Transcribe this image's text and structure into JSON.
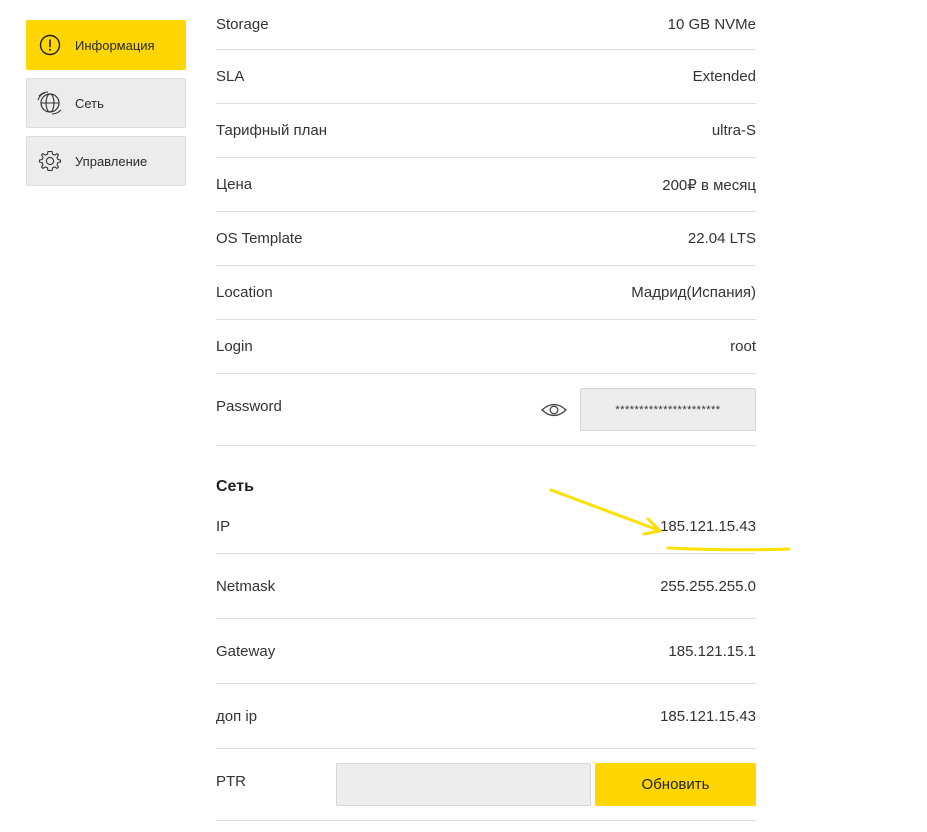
{
  "sidebar": {
    "items": [
      {
        "label": "Информация",
        "icon": "info-circle-icon",
        "active": true
      },
      {
        "label": "Сеть",
        "icon": "network-icon",
        "active": false
      },
      {
        "label": "Управление",
        "icon": "gear-icon",
        "active": false
      }
    ]
  },
  "info": {
    "rows": [
      {
        "label": "Storage",
        "value": "10 GB NVMe"
      },
      {
        "label": "SLA",
        "value": "Extended"
      },
      {
        "label": "Тарифный план",
        "value": "ultra-S"
      },
      {
        "label": "Цена",
        "value": "200₽ в месяц"
      },
      {
        "label": "OS Template",
        "value": "22.04 LTS"
      },
      {
        "label": "Location",
        "value": "Мадрид(Испания)"
      },
      {
        "label": "Login",
        "value": "root"
      }
    ],
    "password": {
      "label": "Password",
      "masked_value": "**********************"
    }
  },
  "network": {
    "title": "Сеть",
    "rows": [
      {
        "label": "IP",
        "value": "185.121.15.43"
      },
      {
        "label": "Netmask",
        "value": "255.255.255.0"
      },
      {
        "label": "Gateway",
        "value": "185.121.15.1"
      },
      {
        "label": "доп ip",
        "value": "185.121.15.43"
      }
    ],
    "ptr": {
      "label": "PTR",
      "input_value": "",
      "button_label": "Обновить"
    }
  },
  "colors": {
    "accent": "#ffd600",
    "field_bg": "#ededed",
    "divider": "#dedede"
  }
}
